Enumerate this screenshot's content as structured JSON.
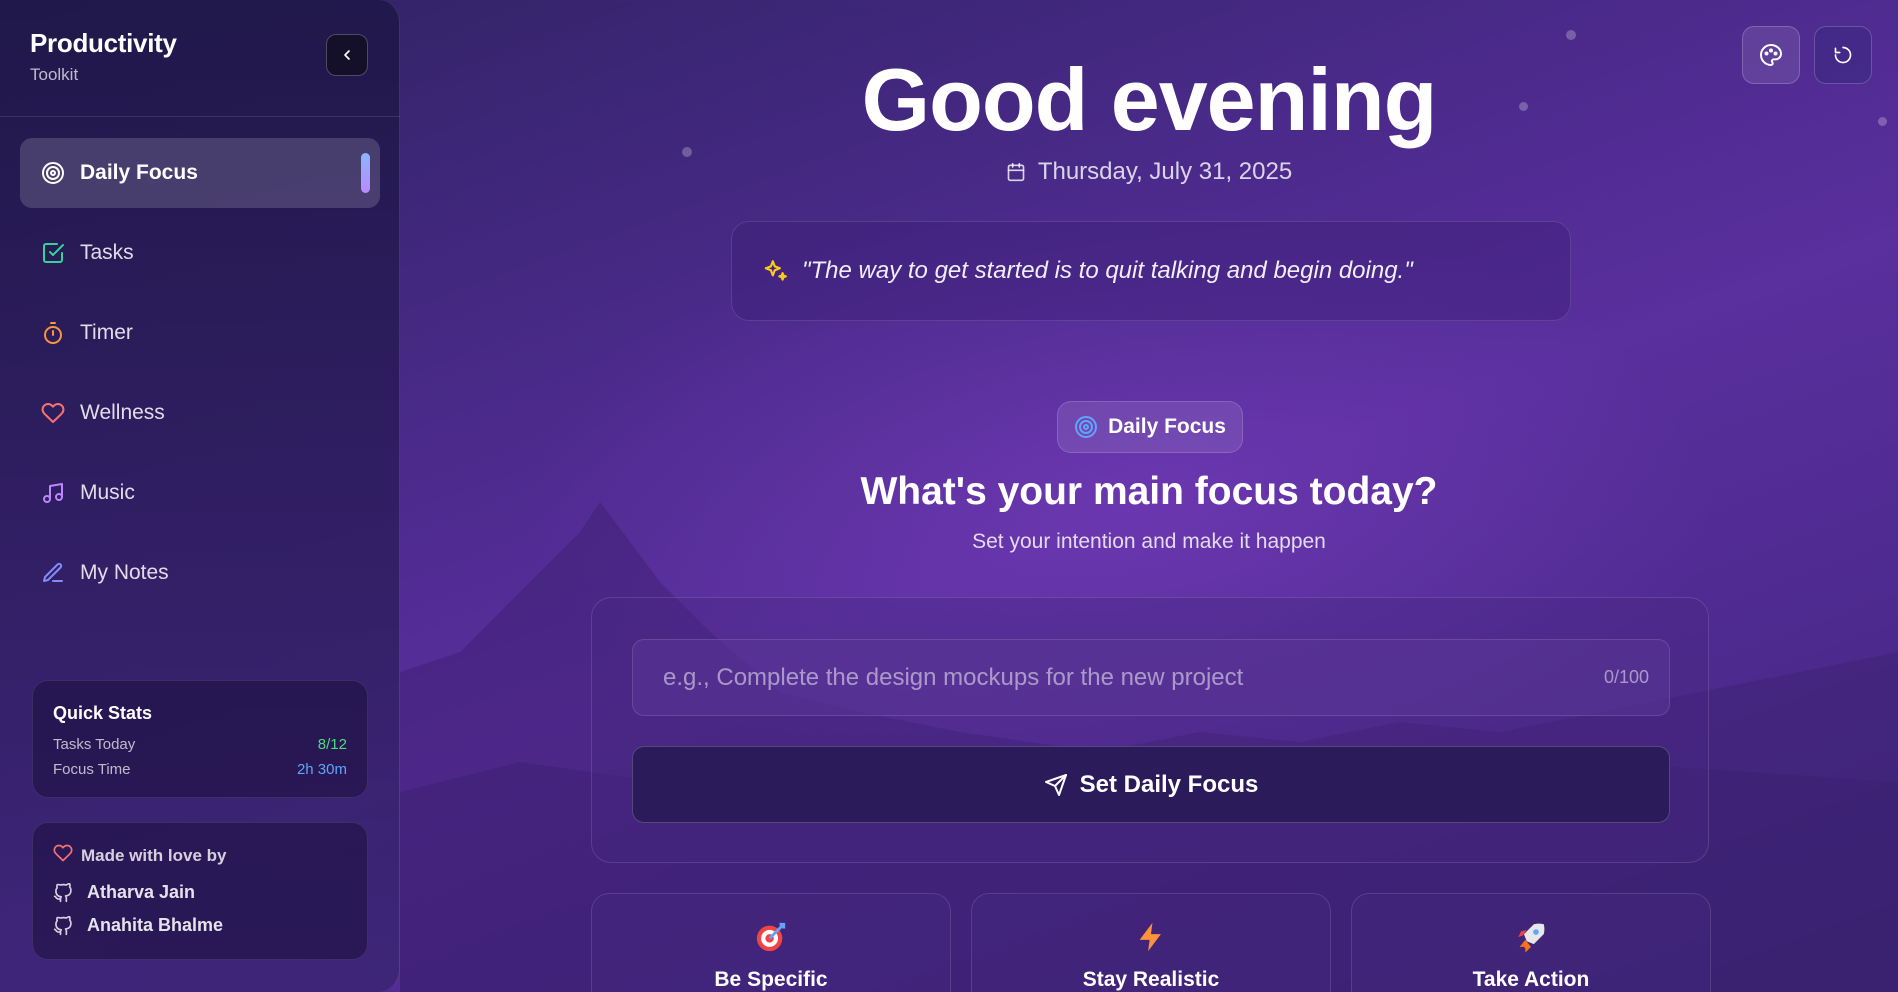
{
  "brand": {
    "title": "Productivity",
    "subtitle": "Toolkit"
  },
  "nav": {
    "items": [
      {
        "label": "Daily Focus",
        "icon": "target-icon",
        "active": true
      },
      {
        "label": "Tasks",
        "icon": "checkbox-icon"
      },
      {
        "label": "Timer",
        "icon": "stopwatch-icon"
      },
      {
        "label": "Wellness",
        "icon": "heart-icon"
      },
      {
        "label": "Music",
        "icon": "music-note-icon"
      },
      {
        "label": "My Notes",
        "icon": "pen-icon"
      }
    ]
  },
  "quick_stats": {
    "title": "Quick Stats",
    "rows": [
      {
        "label": "Tasks Today",
        "value": "8/12"
      },
      {
        "label": "Focus Time",
        "value": "2h 30m"
      }
    ]
  },
  "credits": {
    "title": "Made with love by",
    "authors": [
      "Atharva Jain",
      "Anahita Bhalme"
    ]
  },
  "main": {
    "greeting": "Good evening",
    "date": "Thursday, July 31, 2025",
    "quote": "\"The way to get started is to quit talking and begin doing.\"",
    "section_pill": "Daily Focus",
    "heading": "What's your main focus today?",
    "subheading": "Set your intention and make it happen",
    "input": {
      "placeholder": "e.g., Complete the design mockups for the new project",
      "value": "",
      "counter": "0/100"
    },
    "submit_label": "Set Daily Focus",
    "tips": [
      {
        "label": "Be Specific",
        "icon": "bullseye-dart-icon"
      },
      {
        "label": "Stay Realistic",
        "icon": "lightning-icon"
      },
      {
        "label": "Take Action",
        "icon": "rocket-icon"
      }
    ]
  },
  "colors": {
    "accent_green": "#4ade80",
    "accent_blue": "#60a5fa",
    "background": "#4a2a8a"
  }
}
